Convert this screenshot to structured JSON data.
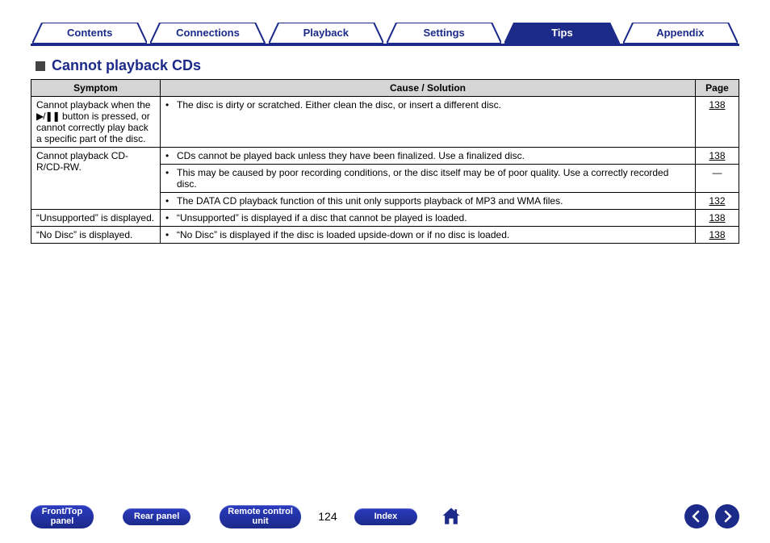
{
  "tabs": [
    {
      "label": "Contents",
      "active": false
    },
    {
      "label": "Connections",
      "active": false
    },
    {
      "label": "Playback",
      "active": false
    },
    {
      "label": "Settings",
      "active": false
    },
    {
      "label": "Tips",
      "active": true
    },
    {
      "label": "Appendix",
      "active": false
    }
  ],
  "heading": "Cannot playback CDs",
  "table": {
    "headers": {
      "symptom": "Symptom",
      "cause": "Cause / Solution",
      "page": "Page"
    },
    "rows": [
      {
        "symptom_pre": "Cannot playback when the ",
        "symptom_icon": "▶/❚❚",
        "symptom_post": " button is pressed, or cannot correctly play back a specific part of the disc.",
        "solutions": [
          {
            "text": "The disc is dirty or scratched. Either clean the disc, or insert a different disc.",
            "page": "138"
          }
        ]
      },
      {
        "symptom": "Cannot playback CD-R/CD-RW.",
        "solutions": [
          {
            "text": "CDs cannot be played back unless they have been finalized. Use a finalized disc.",
            "page": "138"
          },
          {
            "text": "This may be caused by poor recording conditions, or the disc itself may be of poor quality. Use a correctly recorded disc.",
            "page": "—"
          },
          {
            "text": "The DATA CD playback function of this unit only supports playback of MP3 and WMA files.",
            "page": "132"
          }
        ]
      },
      {
        "symptom": "“Unsupported” is displayed.",
        "solutions": [
          {
            "text": "“Unsupported” is displayed if a disc that cannot be played is loaded.",
            "page": "138"
          }
        ]
      },
      {
        "symptom": "“No Disc” is displayed.",
        "solutions": [
          {
            "text": "“No Disc” is displayed if the disc is loaded upside-down or if no disc is loaded.",
            "page": "138"
          }
        ]
      }
    ]
  },
  "bottom": {
    "front_top": "Front/Top panel",
    "rear": "Rear panel",
    "remote": "Remote control unit",
    "page": "124",
    "index": "Index"
  }
}
